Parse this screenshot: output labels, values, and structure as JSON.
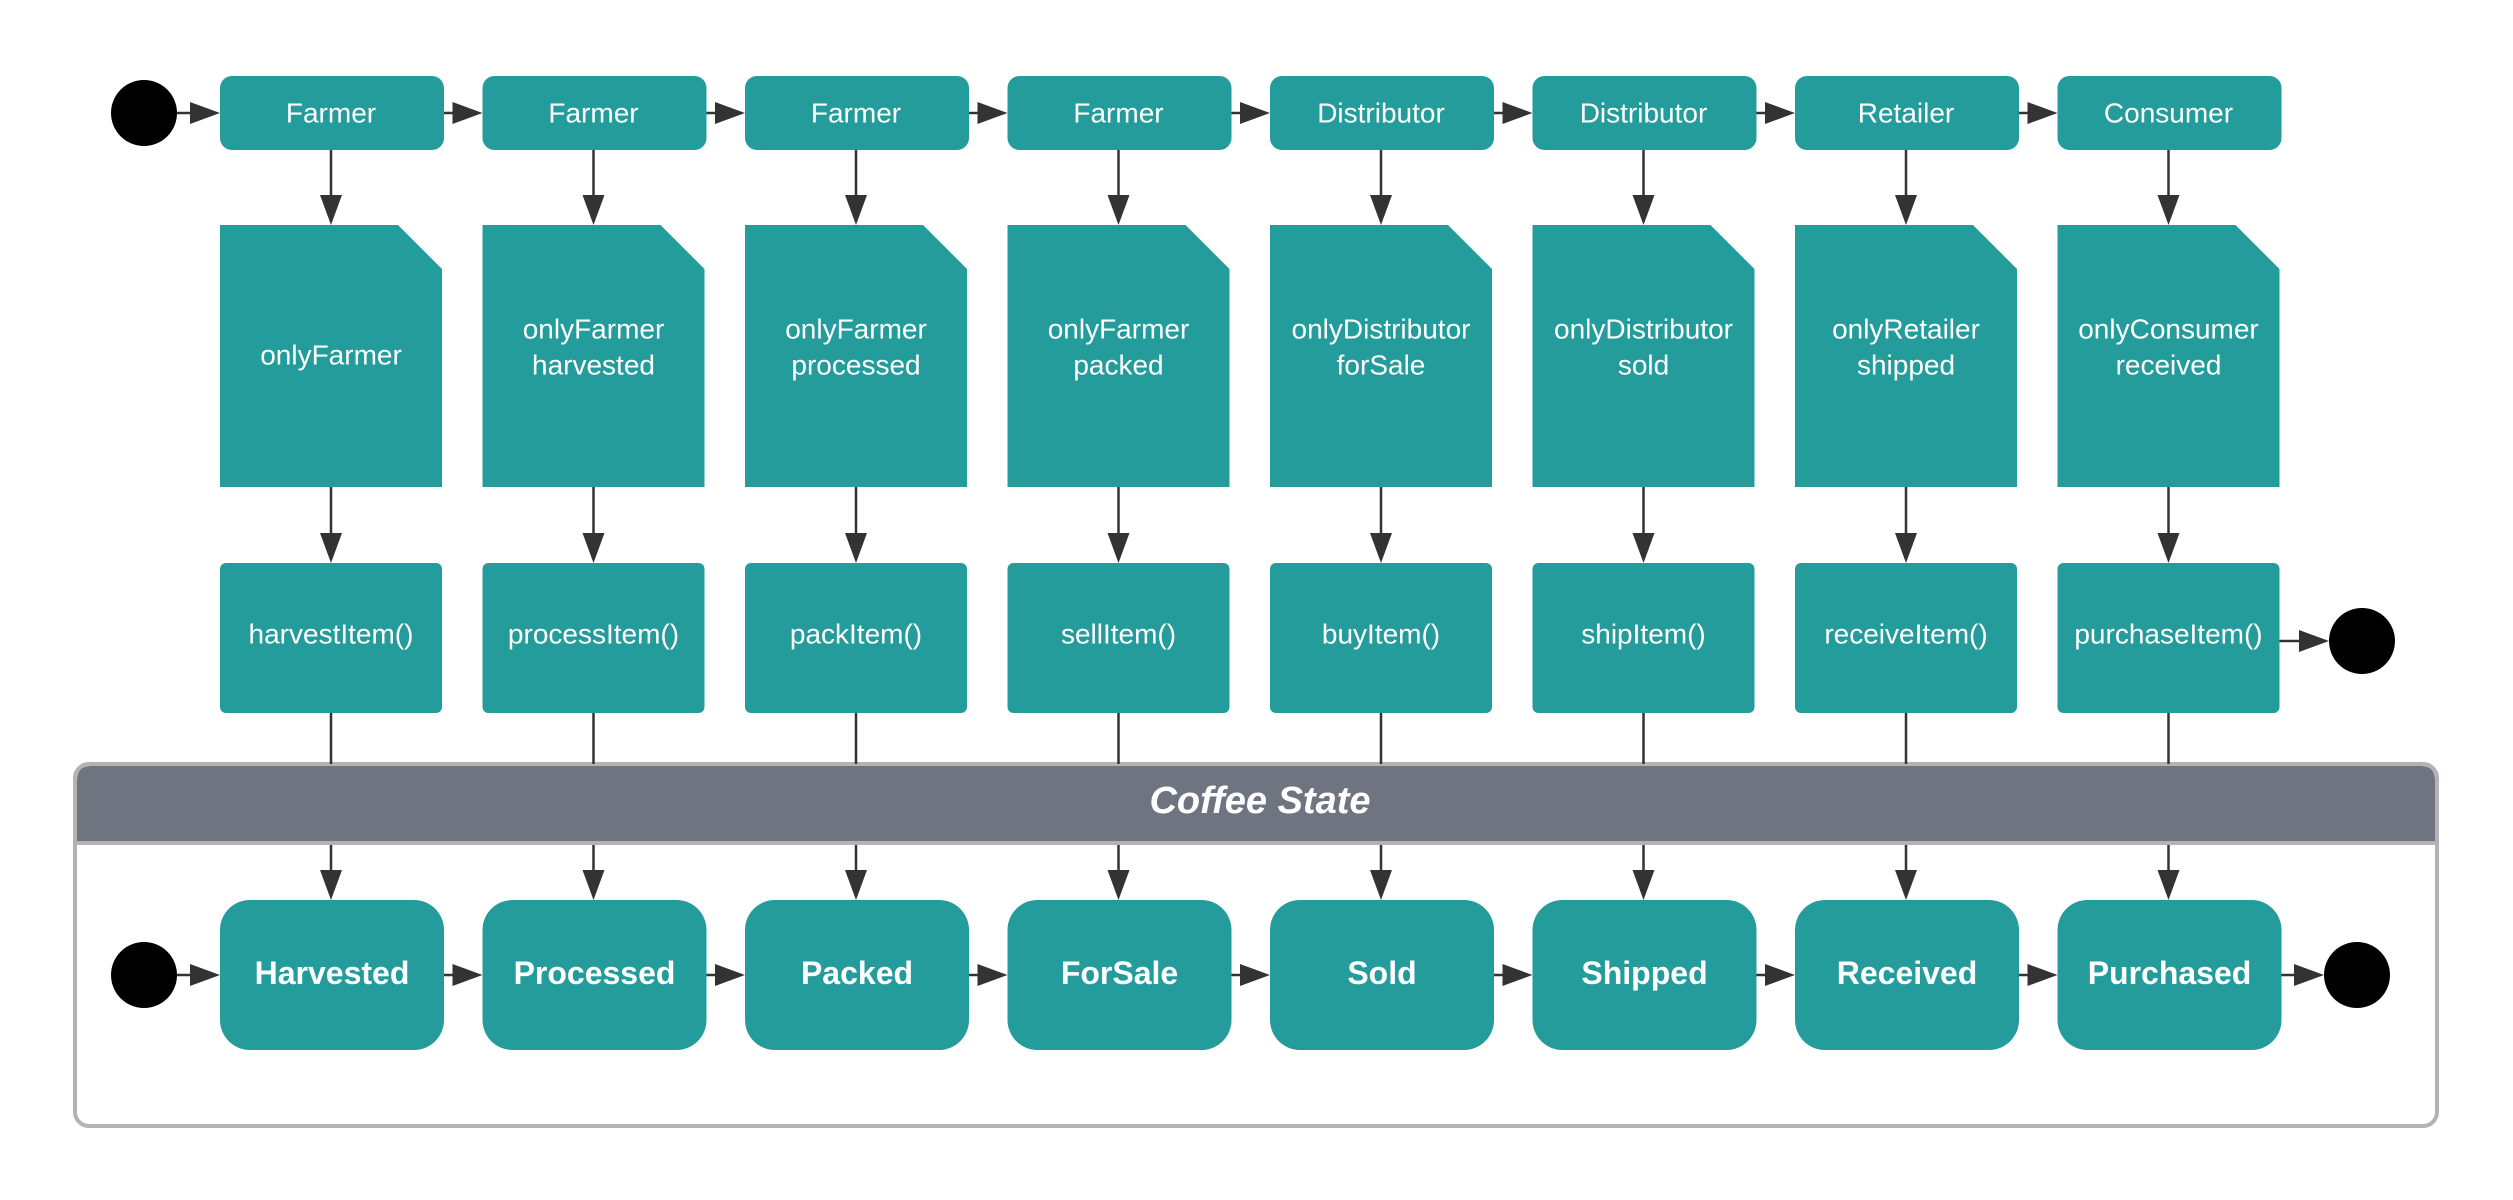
{
  "colors": {
    "node_fill": "#259c9c",
    "node_text": "#ffffff",
    "edge": "#333333",
    "pseudo_state": "#000000",
    "frame_header": "#6f7580",
    "frame_border": "#b3b3b3"
  },
  "roles": [
    {
      "label": "Farmer"
    },
    {
      "label": "Farmer"
    },
    {
      "label": "Farmer"
    },
    {
      "label": "Farmer"
    },
    {
      "label": "Distributor"
    },
    {
      "label": "Distributor"
    },
    {
      "label": "Retailer"
    },
    {
      "label": "Consumer"
    }
  ],
  "modifiers": [
    {
      "lines": [
        "onlyFarmer"
      ]
    },
    {
      "lines": [
        "onlyFarmer",
        "harvested"
      ]
    },
    {
      "lines": [
        "onlyFarmer",
        "processed"
      ]
    },
    {
      "lines": [
        "onlyFarmer",
        "packed"
      ]
    },
    {
      "lines": [
        "onlyDistributor",
        "forSale"
      ]
    },
    {
      "lines": [
        "onlyDistributor",
        "sold"
      ]
    },
    {
      "lines": [
        "onlyRetailer",
        "shipped"
      ]
    },
    {
      "lines": [
        "onlyConsumer",
        "received"
      ]
    }
  ],
  "functions": [
    {
      "label": "harvestItem()"
    },
    {
      "label": "processItem()"
    },
    {
      "label": "packItem()"
    },
    {
      "label": "sellItem()"
    },
    {
      "label": "buyItem()"
    },
    {
      "label": "shipItem()"
    },
    {
      "label": "receiveItem()"
    },
    {
      "label": "purchaseItem()"
    }
  ],
  "state_frame": {
    "title": "Coffee State",
    "states": [
      {
        "label": "Harvested"
      },
      {
        "label": "Processed"
      },
      {
        "label": "Packed"
      },
      {
        "label": "ForSale"
      },
      {
        "label": "Sold"
      },
      {
        "label": "Shipped"
      },
      {
        "label": "Received"
      },
      {
        "label": "Purchased"
      }
    ]
  },
  "pseudo_states": {
    "role_row": {
      "initial": true,
      "final": false
    },
    "function_row": {
      "initial": false,
      "final": true
    },
    "state_row": {
      "initial": true,
      "final": true
    }
  }
}
